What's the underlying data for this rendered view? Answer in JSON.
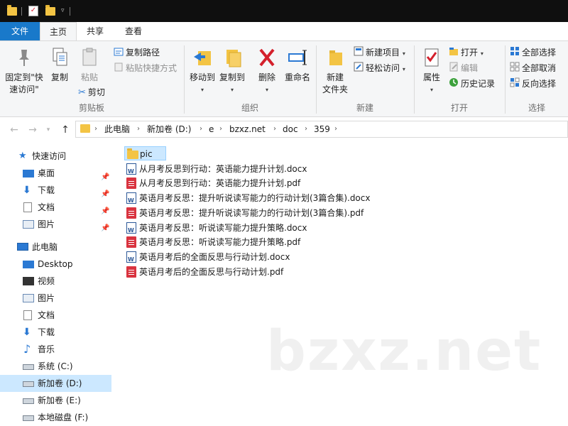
{
  "ribbon_tabs": [
    "文件",
    "主页",
    "共享",
    "查看"
  ],
  "clipboard": {
    "pin_label": "固定到\"快速访问\"",
    "copy_label": "复制",
    "paste_label": "粘贴",
    "copy_path_label": "复制路径",
    "paste_shortcut_label": "粘贴快捷方式",
    "cut_label": "剪切",
    "group_label": "剪贴板"
  },
  "organize": {
    "move_to_label": "移动到",
    "copy_to_label": "复制到",
    "delete_label": "删除",
    "rename_label": "重命名",
    "group_label": "组织"
  },
  "new": {
    "new_folder_label": "新建\n文件夹",
    "new_item_label": "新建项目",
    "easy_access_label": "轻松访问",
    "group_label": "新建"
  },
  "open": {
    "properties_label": "属性",
    "open_label": "打开",
    "edit_label": "编辑",
    "history_label": "历史记录",
    "group_label": "打开"
  },
  "select": {
    "select_all_label": "全部选择",
    "select_none_label": "全部取消",
    "invert_label": "反向选择",
    "group_label": "选择"
  },
  "breadcrumb": [
    "此电脑",
    "新加卷 (D:)",
    "e",
    "bzxz.net",
    "doc",
    "359"
  ],
  "nav_pane": {
    "quick_access": "快速访问",
    "quick_items": [
      "桌面",
      "下载",
      "文档",
      "图片"
    ],
    "this_pc": "此电脑",
    "pc_items": [
      "Desktop",
      "视频",
      "图片",
      "文档",
      "下载",
      "音乐",
      "系统 (C:)",
      "新加卷 (D:)",
      "新加卷 (E:)",
      "本地磁盘 (F:)"
    ]
  },
  "files": [
    {
      "name": "pic",
      "type": "folder"
    },
    {
      "name": "从月考反思到行动：英语能力提升计划.docx",
      "type": "docx"
    },
    {
      "name": "从月考反思到行动：英语能力提升计划.pdf",
      "type": "pdf"
    },
    {
      "name": "英语月考反思：提升听说读写能力的行动计划(3篇合集).docx",
      "type": "docx"
    },
    {
      "name": "英语月考反思：提升听说读写能力的行动计划(3篇合集).pdf",
      "type": "pdf"
    },
    {
      "name": "英语月考反思：听说读写能力提升策略.docx",
      "type": "docx"
    },
    {
      "name": "英语月考反思：听说读写能力提升策略.pdf",
      "type": "pdf"
    },
    {
      "name": "英语月考后的全面反思与行动计划.docx",
      "type": "docx"
    },
    {
      "name": "英语月考后的全面反思与行动计划.pdf",
      "type": "pdf"
    }
  ],
  "watermark": "bzxz.net",
  "colors": {
    "accent": "#1979ca",
    "selection": "#cce8ff",
    "folder": "#f3c444",
    "pdf": "#d9333f",
    "word": "#2b5797"
  }
}
